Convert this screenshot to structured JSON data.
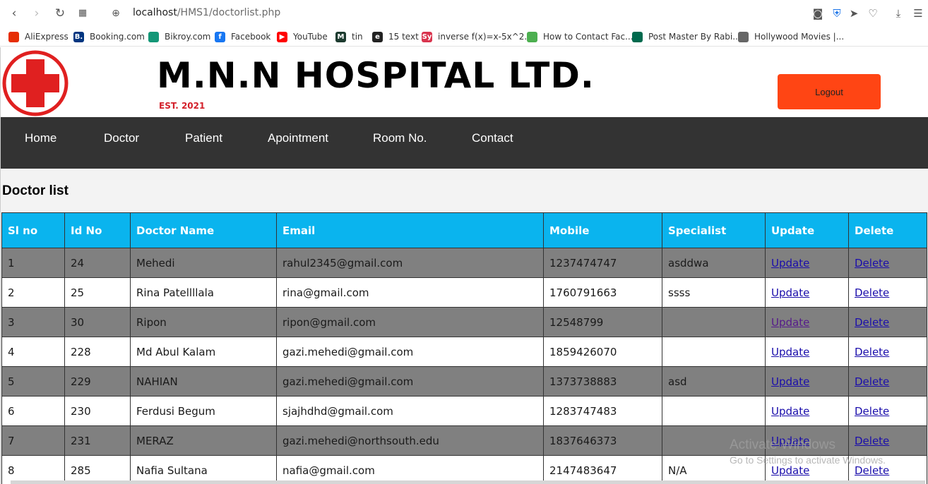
{
  "browser": {
    "url_host": "localhost",
    "url_path": "/HMS1/doctorlist.php",
    "bookmarks": [
      {
        "label": "AliExpress",
        "icon": "aliexpress-icon",
        "color": "#e62e04",
        "glyph": ""
      },
      {
        "label": "Booking.com",
        "icon": "booking-icon",
        "color": "#003580",
        "glyph": "B."
      },
      {
        "label": "Bikroy.com",
        "icon": "bikroy-icon",
        "color": "#149777",
        "glyph": ""
      },
      {
        "label": "Facebook",
        "icon": "facebook-icon",
        "color": "#1877f2",
        "glyph": "f"
      },
      {
        "label": "YouTube",
        "icon": "youtube-icon",
        "color": "#ff0000",
        "glyph": "▶"
      },
      {
        "label": "tin",
        "icon": "tin-icon",
        "color": "#1d3b2f",
        "glyph": "M"
      },
      {
        "label": "15 text",
        "icon": "text-icon",
        "color": "#222222",
        "glyph": "e"
      },
      {
        "label": "inverse f(x)=x-5x^2...",
        "icon": "symbolab-icon",
        "color": "#d9344e",
        "glyph": "Sy"
      },
      {
        "label": "How to Contact Fac...",
        "icon": "map-pin-icon",
        "color": "#4caf50",
        "glyph": ""
      },
      {
        "label": "Post Master By Rabi...",
        "icon": "bangladesh-flag-icon",
        "color": "#006a4e",
        "glyph": ""
      },
      {
        "label": "Hollywood Movies |...",
        "icon": "document-icon",
        "color": "#666666",
        "glyph": ""
      }
    ]
  },
  "header": {
    "title": "M.N.N HOSPITAL LTD.",
    "est": "EST. 2021",
    "logout_label": "Logout"
  },
  "nav": [
    "Home",
    "Doctor",
    "Patient",
    "Apointment",
    "Room No.",
    "Contact"
  ],
  "page_heading": "Doctor list",
  "table": {
    "columns": [
      "Sl no",
      "Id No",
      "Doctor Name",
      "Email",
      "Mobile",
      "Specialist",
      "Update",
      "Delete"
    ],
    "rows": [
      {
        "sl": "1",
        "id": "24",
        "name": "Mehedi",
        "email": "rahul2345@gmail.com",
        "mobile": "1237474747",
        "specialist": "asddwa",
        "update": "Update",
        "delete": "Delete"
      },
      {
        "sl": "2",
        "id": "25",
        "name": "Rina Patellllala",
        "email": "rina@gmail.com",
        "mobile": "1760791663",
        "specialist": "ssss",
        "update": "Update",
        "delete": "Delete"
      },
      {
        "sl": "3",
        "id": "30",
        "name": "Ripon",
        "email": "ripon@gmail.com",
        "mobile": "12548799",
        "specialist": "",
        "update": "Update",
        "delete": "Delete",
        "update_visited": true
      },
      {
        "sl": "4",
        "id": "228",
        "name": "Md Abul Kalam",
        "email": "gazi.mehedi@gmail.com",
        "mobile": "1859426070",
        "specialist": "",
        "update": "Update",
        "delete": "Delete"
      },
      {
        "sl": "5",
        "id": "229",
        "name": "NAHIAN",
        "email": "gazi.mehedi@gmail.com",
        "mobile": "1373738883",
        "specialist": "asd",
        "update": "Update",
        "delete": "Delete"
      },
      {
        "sl": "6",
        "id": "230",
        "name": "Ferdusi Begum",
        "email": "sjajhdhd@gmail.com",
        "mobile": "1283747483",
        "specialist": "",
        "update": "Update",
        "delete": "Delete"
      },
      {
        "sl": "7",
        "id": "231",
        "name": "MERAZ",
        "email": "gazi.mehedi@northsouth.edu",
        "mobile": "1837646373",
        "specialist": "",
        "update": "Update",
        "delete": "Delete"
      },
      {
        "sl": "8",
        "id": "285",
        "name": "Nafia Sultana",
        "email": "nafia@gmail.com",
        "mobile": "2147483647",
        "specialist": "N/A",
        "update": "Update",
        "delete": "Delete"
      }
    ]
  },
  "watermark": {
    "line1": "Activate Windows",
    "line2": "Go to Settings to activate Windows."
  },
  "colors": {
    "header_cell": "#0ab4ee",
    "nav_bar": "#333333",
    "logout": "#ff4514",
    "odd_row": "#808080",
    "brand_red": "#e02020"
  }
}
